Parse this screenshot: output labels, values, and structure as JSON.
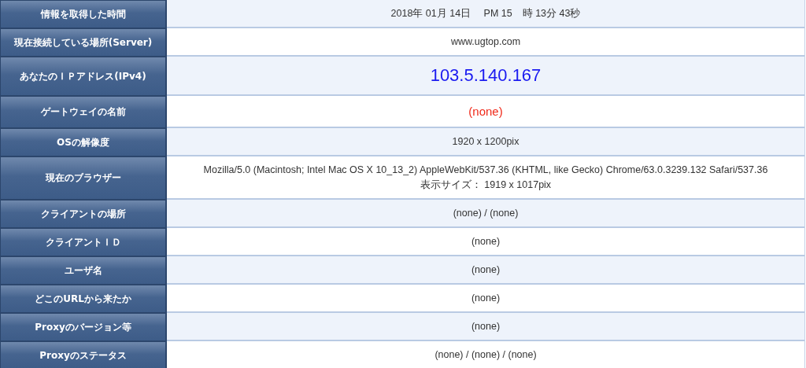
{
  "rows": [
    {
      "label": "情報を取得した時間",
      "kind": "text",
      "lines": [
        "2018年 01月 14日　 PM 15　時 13分 43秒"
      ]
    },
    {
      "label": "現在接続している場所(Server)",
      "kind": "text",
      "lines": [
        "www.ugtop.com"
      ]
    },
    {
      "label": "あなたのＩＰアドレス(IPv4)",
      "kind": "address",
      "lines": [
        "103.5.140.167"
      ]
    },
    {
      "label": "ゲートウェイの名前",
      "kind": "alert",
      "lines": [
        "(none)"
      ]
    },
    {
      "label": "OSの解像度",
      "kind": "text",
      "lines": [
        "1920 x 1200pix"
      ]
    },
    {
      "label": "現在のブラウザー",
      "kind": "text",
      "lines": [
        "Mozilla/5.0 (Macintosh; Intel Mac OS X 10_13_2) AppleWebKit/537.36 (KHTML, like Gecko) Chrome/63.0.3239.132 Safari/537.36",
        "表示サイズ： 1919 x 1017pix"
      ]
    },
    {
      "label": "クライアントの場所",
      "kind": "text",
      "lines": [
        "(none) / (none)"
      ]
    },
    {
      "label": "クライアントＩＤ",
      "kind": "text",
      "lines": [
        "(none)"
      ]
    },
    {
      "label": "ユーザ名",
      "kind": "text",
      "lines": [
        "(none)"
      ]
    },
    {
      "label": "どこのURLから来たか",
      "kind": "text",
      "lines": [
        "(none)"
      ]
    },
    {
      "label": "Proxyのバージョン等",
      "kind": "text",
      "lines": [
        "(none)"
      ]
    },
    {
      "label": "Proxyのステータス",
      "kind": "text",
      "lines": [
        "(none) / (none) / (none)"
      ]
    }
  ]
}
